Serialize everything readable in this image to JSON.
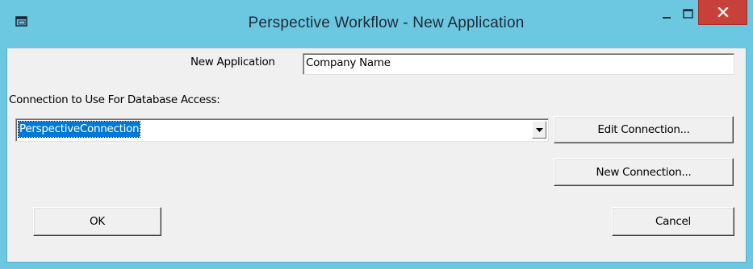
{
  "window": {
    "title": "Perspective Workflow -  New Application",
    "icon": "app-window-icon",
    "controls": {
      "minimize": "minimize-icon",
      "maximize": "maximize-icon",
      "close": "close-icon"
    },
    "colors": {
      "frame": "#6cc7e0",
      "close": "#c7403a",
      "selection": "#0078d7",
      "client": "#f0f0f0"
    }
  },
  "form": {
    "new_application_label": "New Application",
    "new_application_value": "Company Name",
    "connection_label": "Connection to Use For Database Access:",
    "connection_selected": "PerspectiveConnection"
  },
  "buttons": {
    "edit_connection": "Edit Connection...",
    "new_connection": "New Connection...",
    "ok": "OK",
    "cancel": "Cancel"
  }
}
